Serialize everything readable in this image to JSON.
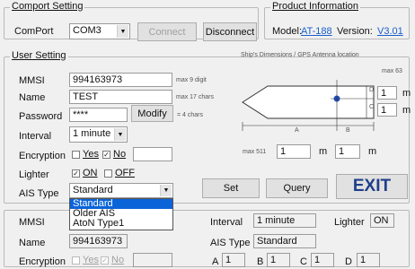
{
  "comport": {
    "legend": "Comport Setting",
    "label": "ComPort",
    "selected": "COM3",
    "connect_label": "Connect",
    "disconnect_label": "Disconnect"
  },
  "product": {
    "legend": "Product Information",
    "model_label": "Model:",
    "model_value": "AT-188",
    "version_label": "Version:",
    "version_value": "V3.01"
  },
  "user": {
    "legend": "User Setting",
    "mmsi_label": "MMSI",
    "mmsi_value": "994163973",
    "mmsi_hint": "max 9 digit",
    "name_label": "Name",
    "name_value": "TEST",
    "name_hint": "max 17 chars",
    "password_label": "Password",
    "password_value": "****",
    "modify_label": "Modify",
    "password_hint": "= 4 chars",
    "interval_label": "Interval",
    "interval_value": "1 minute",
    "encryption_label": "Encryption",
    "enc_yes": "Yes",
    "enc_no": "No",
    "lighter_label": "Lighter",
    "light_on": "ON",
    "light_off": "OFF",
    "ais_label": "AIS Type",
    "ais_value": "Standard",
    "ais_options": [
      "Standard",
      "Older AIS",
      "AtoN Type1"
    ]
  },
  "ship": {
    "title": "Ship's Dimensions / GPS Antenna location",
    "max63": "max 63",
    "d_value": "1",
    "c_value": "1",
    "unit": "m",
    "max511": "max 511",
    "a_value": "1",
    "b_value": "1",
    "labels": {
      "a": "A",
      "b": "B",
      "c": "C",
      "d": "D"
    }
  },
  "actions": {
    "set_label": "Set",
    "query_label": "Query",
    "exit_label": "EXIT"
  },
  "status": {
    "mmsi_label": "MMSI",
    "mmsi_value": "994163973",
    "name_label": "Name",
    "name_value": "994163973",
    "encryption_label": "Encryption",
    "enc_yes": "Yes",
    "enc_no": "No",
    "interval_label": "Interval",
    "interval_value": "1 minute",
    "lighter_label": "Lighter",
    "lighter_value": "ON",
    "ais_label": "AIS Type",
    "ais_value": "Standard",
    "a_label": "A",
    "a_value": "1",
    "b_label": "B",
    "b_value": "1",
    "c_label": "C",
    "c_value": "1",
    "d_label": "D",
    "d_value": "1"
  },
  "colors": {
    "link": "#1a5ec9",
    "highlight": "#0a64d8",
    "exit_text": "#1f3f8a"
  }
}
